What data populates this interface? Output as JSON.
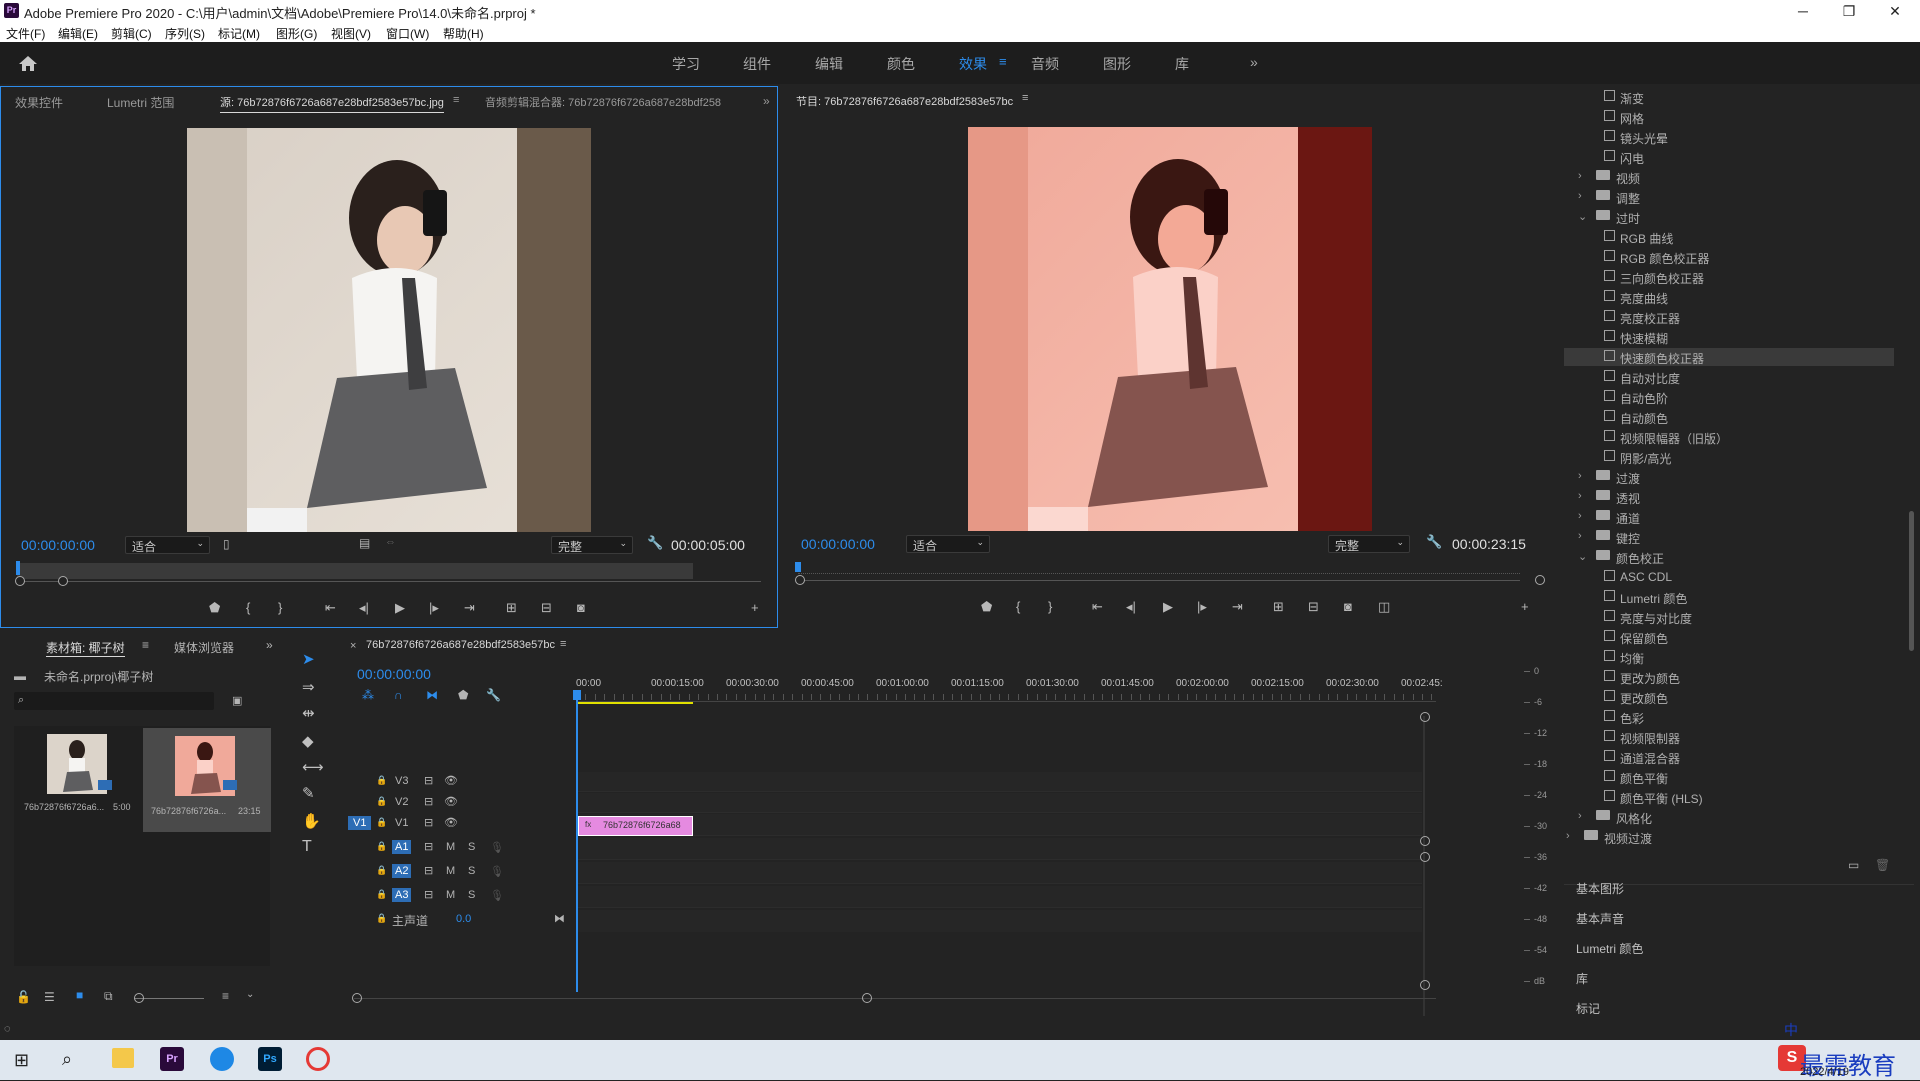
{
  "titlebar": {
    "title": "Adobe Premiere Pro 2020 - C:\\用户\\admin\\文档\\Adobe\\Premiere Pro\\14.0\\未命名.prproj *",
    "pr_icon": "Pr"
  },
  "menu": [
    "文件(F)",
    "编辑(E)",
    "剪辑(C)",
    "序列(S)",
    "标记(M)",
    "图形(G)",
    "视图(V)",
    "窗口(W)",
    "帮助(H)"
  ],
  "workspaces": [
    "学习",
    "组件",
    "编辑",
    "颜色",
    "效果",
    "音频",
    "图形",
    "库"
  ],
  "active_workspace": "效果",
  "source_panel": {
    "tabs": [
      "效果控件",
      "Lumetri 范围",
      "源: 76b72876f6726a687e28bdf2583e57bc.jpg",
      "音频剪辑混合器: 76b72876f6726a687e28bdf258"
    ],
    "timecode": "00:00:00:00",
    "fit": "适合",
    "quality": "完整",
    "duration": "00:00:05:00"
  },
  "program_panel": {
    "title": "节目: 76b72876f6726a687e28bdf2583e57bc",
    "timecode": "00:00:00:00",
    "fit": "适合",
    "quality": "完整",
    "duration": "00:00:23:15"
  },
  "project_panel": {
    "tabs": [
      "素材箱: 椰子树",
      "媒体浏览器"
    ],
    "path": "未命名.prproj\\椰子树",
    "items": [
      {
        "name": "76b72876f6726a6...",
        "duration": "5:00"
      },
      {
        "name": "76b72876f6726a...",
        "duration": "23:15"
      }
    ]
  },
  "timeline": {
    "tab": "76b72876f6726a687e28bdf2583e57bc",
    "timecode": "00:00:00:00",
    "ruler": [
      "00:00",
      "00:00:15:00",
      "00:00:30:00",
      "00:00:45:00",
      "00:01:00:00",
      "00:01:15:00",
      "00:01:30:00",
      "00:01:45:00",
      "00:02:00:00",
      "00:02:15:00",
      "00:02:30:00",
      "00:02:45:"
    ],
    "video_tracks": [
      "V3",
      "V2",
      "V1"
    ],
    "audio_tracks": [
      "A1",
      "A2",
      "A3"
    ],
    "source_patch": "V1",
    "master": "主声道",
    "master_value": "0.0",
    "clip_label": "76b72876f6726a68",
    "mute": "M",
    "solo": "S",
    "db_scale": [
      "0",
      "-6",
      "-12",
      "-18",
      "-24",
      "-30",
      "-36",
      "-42",
      "-48",
      "-54",
      "dB"
    ]
  },
  "effects_panel": {
    "items": [
      {
        "label": "渐变",
        "kind": "fx",
        "indent": 2
      },
      {
        "label": "网格",
        "kind": "fx",
        "indent": 2
      },
      {
        "label": "镜头光晕",
        "kind": "fx",
        "indent": 2
      },
      {
        "label": "闪电",
        "kind": "fx",
        "indent": 2
      },
      {
        "label": "视频",
        "kind": "folder",
        "indent": 1,
        "open": false
      },
      {
        "label": "调整",
        "kind": "folder",
        "indent": 1,
        "open": false
      },
      {
        "label": "过时",
        "kind": "folder",
        "indent": 1,
        "open": true
      },
      {
        "label": "RGB 曲线",
        "kind": "fx",
        "indent": 2
      },
      {
        "label": "RGB 颜色校正器",
        "kind": "fx",
        "indent": 2
      },
      {
        "label": "三向颜色校正器",
        "kind": "fx",
        "indent": 2
      },
      {
        "label": "亮度曲线",
        "kind": "fx",
        "indent": 2
      },
      {
        "label": "亮度校正器",
        "kind": "fx",
        "indent": 2
      },
      {
        "label": "快速模糊",
        "kind": "fx",
        "indent": 2
      },
      {
        "label": "快速颜色校正器",
        "kind": "fx",
        "indent": 2,
        "selected": true
      },
      {
        "label": "自动对比度",
        "kind": "fx",
        "indent": 2
      },
      {
        "label": "自动色阶",
        "kind": "fx",
        "indent": 2
      },
      {
        "label": "自动颜色",
        "kind": "fx",
        "indent": 2
      },
      {
        "label": "视频限幅器（旧版）",
        "kind": "fx",
        "indent": 2
      },
      {
        "label": "阴影/高光",
        "kind": "fx",
        "indent": 2
      },
      {
        "label": "过渡",
        "kind": "folder",
        "indent": 1,
        "open": false
      },
      {
        "label": "透视",
        "kind": "folder",
        "indent": 1,
        "open": false
      },
      {
        "label": "通道",
        "kind": "folder",
        "indent": 1,
        "open": false
      },
      {
        "label": "键控",
        "kind": "folder",
        "indent": 1,
        "open": false
      },
      {
        "label": "颜色校正",
        "kind": "folder",
        "indent": 1,
        "open": true
      },
      {
        "label": "ASC CDL",
        "kind": "fx",
        "indent": 2
      },
      {
        "label": "Lumetri 颜色",
        "kind": "fx",
        "indent": 2
      },
      {
        "label": "亮度与对比度",
        "kind": "fx",
        "indent": 2
      },
      {
        "label": "保留颜色",
        "kind": "fx",
        "indent": 2
      },
      {
        "label": "均衡",
        "kind": "fx",
        "indent": 2
      },
      {
        "label": "更改为颜色",
        "kind": "fx",
        "indent": 2
      },
      {
        "label": "更改颜色",
        "kind": "fx",
        "indent": 2
      },
      {
        "label": "色彩",
        "kind": "fx",
        "indent": 2
      },
      {
        "label": "视频限制器",
        "kind": "fx",
        "indent": 2
      },
      {
        "label": "通道混合器",
        "kind": "fx",
        "indent": 2
      },
      {
        "label": "颜色平衡",
        "kind": "fx",
        "indent": 2
      },
      {
        "label": "颜色平衡 (HLS)",
        "kind": "fx",
        "indent": 2
      },
      {
        "label": "风格化",
        "kind": "folder",
        "indent": 1,
        "open": false
      },
      {
        "label": "视频过渡",
        "kind": "folder",
        "indent": 0,
        "open": false
      }
    ],
    "sections": [
      "基本图形",
      "基本声音",
      "Lumetri 颜色",
      "库",
      "标记"
    ]
  },
  "taskbar": {
    "date": "2022/4/19",
    "ime": "中",
    "watermark": "最需教育"
  },
  "colors": {
    "accent": "#2d8ceb",
    "clip": "#e58ae0",
    "bg": "#232323"
  }
}
